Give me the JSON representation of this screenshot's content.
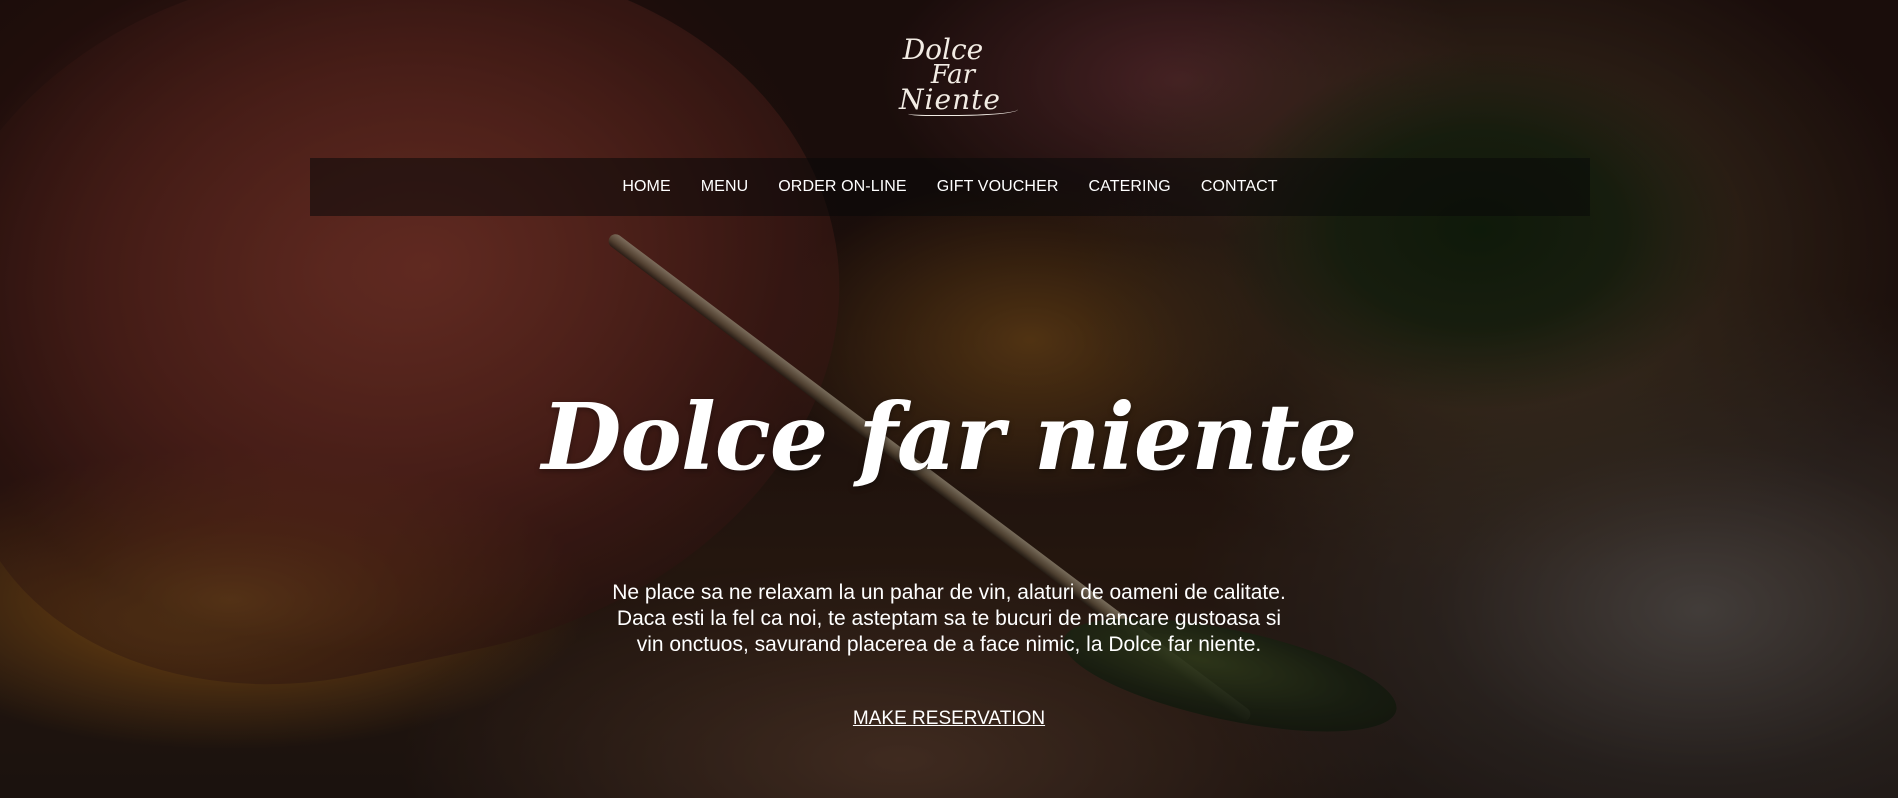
{
  "logo": {
    "line1": "Dolce",
    "line2": "Far",
    "line3": "Niente"
  },
  "nav": {
    "items": [
      {
        "label": "HOME"
      },
      {
        "label": "MENU"
      },
      {
        "label": "ORDER ON-LINE"
      },
      {
        "label": "GIFT VOUCHER"
      },
      {
        "label": "CATERING"
      },
      {
        "label": "CONTACT"
      }
    ]
  },
  "hero": {
    "title": "Dolce far niente",
    "description": "Ne place sa ne relaxam la un pahar de vin, alaturi de oameni de calitate. Daca esti la fel ca noi, te asteptam sa te bucuri de mancare gustoasa si vin onctuos, savurand placerea de a face nimic, la Dolce far niente.",
    "cta_label": "MAKE RESERVATION"
  },
  "colors": {
    "text": "#ffffff",
    "nav_background": "#0a0a0a"
  }
}
